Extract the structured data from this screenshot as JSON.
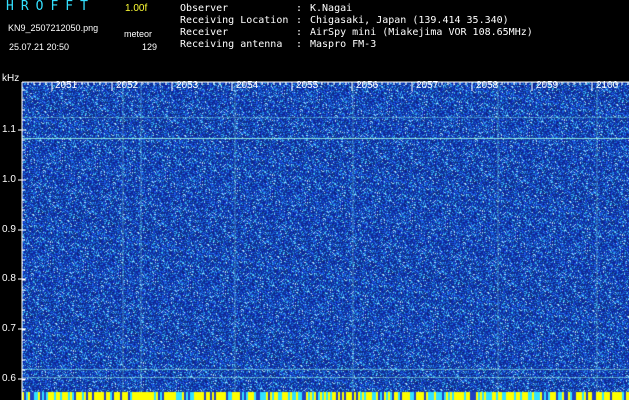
{
  "header": {
    "app_name": "HROFFT",
    "version": "1.00f",
    "filename": "KN9_2507212050.png",
    "mode": "meteor",
    "datetime": "25.07.21 20:50",
    "count": "129"
  },
  "info": [
    {
      "key": "Observer",
      "value": "K.Nagai"
    },
    {
      "key": "Receiving Location",
      "value": "Chigasaki, Japan (139.414 35.340)"
    },
    {
      "key": "Receiver",
      "value": "AirSpy mini (Miakejima VOR 108.65MHz)"
    },
    {
      "key": "Receiving antenna",
      "value": "Maspro FM-3"
    }
  ],
  "axis": {
    "y_unit": "kHz",
    "y_ticks": [
      "1.1",
      "1.0",
      "0.9",
      "0.8",
      "0.7",
      "0.6"
    ],
    "x_ticks": [
      "2051",
      "2052",
      "2053",
      "2054",
      "2055",
      "2056",
      "2057",
      "2058",
      "2059",
      "2100"
    ]
  },
  "colors": {
    "background": "#000000",
    "app_name": "#33e0ff",
    "version": "#ffff33",
    "spectrogram_base": "#1a3dc8",
    "noise_light": "#7fd8ff",
    "carrier_line": "#9fffe8",
    "bottom_bar": "#ffff00"
  }
}
